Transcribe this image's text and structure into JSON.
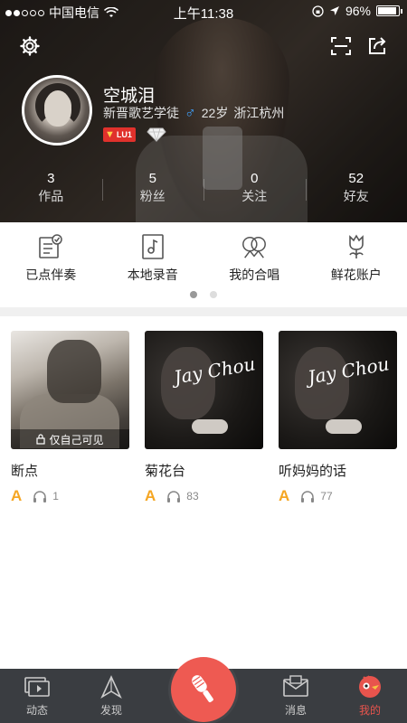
{
  "status_bar": {
    "carrier": "中国电信",
    "time": "上午11:38",
    "battery": "96%"
  },
  "profile": {
    "username": "空城泪",
    "title": "新晋歌艺学徒",
    "age": "22岁",
    "location": "浙江杭州",
    "level": "LU1"
  },
  "stats": [
    {
      "value": "3",
      "label": "作品"
    },
    {
      "value": "5",
      "label": "粉丝"
    },
    {
      "value": "0",
      "label": "关注"
    },
    {
      "value": "52",
      "label": "好友"
    }
  ],
  "menu": [
    {
      "label": "已点伴奏",
      "icon": "checklist-icon"
    },
    {
      "label": "本地录音",
      "icon": "music-note-icon"
    },
    {
      "label": "我的合唱",
      "icon": "duet-icon"
    },
    {
      "label": "鲜花账户",
      "icon": "flower-icon"
    }
  ],
  "songs": [
    {
      "title": "断点",
      "grade": "A",
      "plays": "1",
      "private_label": "仅自己可见"
    },
    {
      "title": "菊花台",
      "grade": "A",
      "plays": "83",
      "cover_text": "Jay Chou"
    },
    {
      "title": "听妈妈的话",
      "grade": "A",
      "plays": "77",
      "cover_text": "Jay Chou"
    }
  ],
  "tabs": [
    {
      "label": "动态",
      "icon": "feed-icon"
    },
    {
      "label": "发现",
      "icon": "discover-icon"
    },
    {
      "label": "消息",
      "icon": "message-icon"
    },
    {
      "label": "我的",
      "icon": "profile-icon"
    }
  ],
  "colors": {
    "accent": "#ee5a52",
    "grade": "#f5a623",
    "male": "#3ea2ff",
    "tabbar": "#3a3d41"
  }
}
